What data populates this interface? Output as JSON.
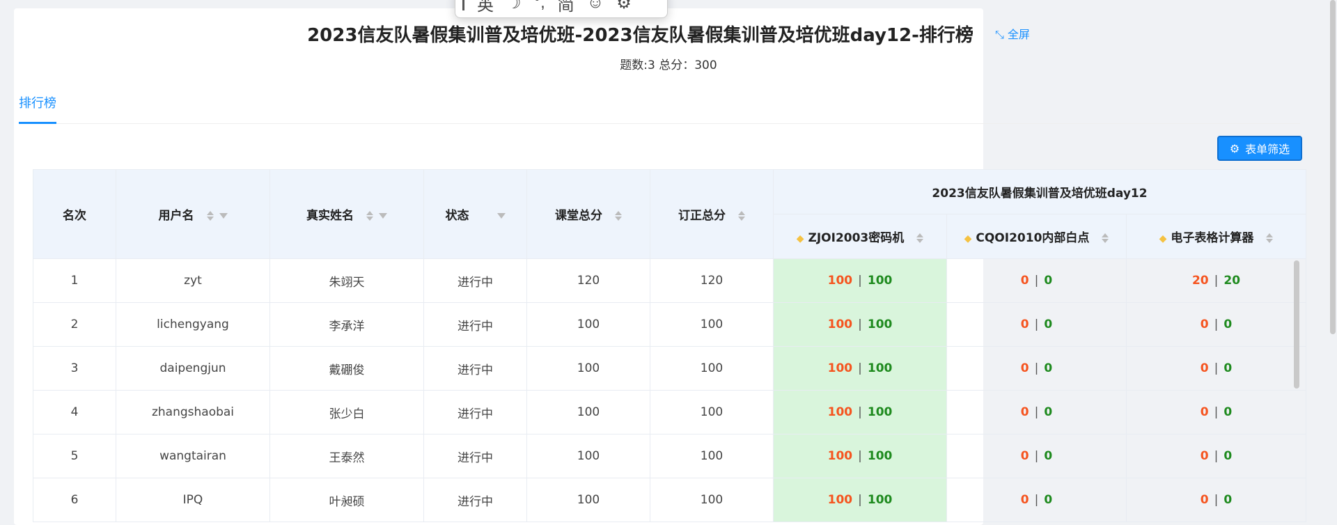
{
  "ime": {
    "lang": "英",
    "moon": "☽",
    "punct": "°,",
    "script": "简",
    "emoji": "☺",
    "settings": "⚙"
  },
  "header": {
    "title": "2023信友队暑假集训普及培优班-2023信友队暑假集训普及培优班day12-排行榜",
    "fullscreen_label": "全屏",
    "subtitle": "题数:3 总分：300"
  },
  "tabs": [
    {
      "label": "排行榜",
      "active": true
    }
  ],
  "filter_button": {
    "label": "表单筛选",
    "icon": "gear-icon"
  },
  "table": {
    "group_header": "2023信友队暑假集训普及培优班day12",
    "columns": [
      "名次",
      "用户名",
      "真实姓名",
      "状态",
      "课堂总分",
      "订正总分"
    ],
    "problems": [
      "ZJOI2003密码机",
      "CQOI2010内部白点",
      "电子表格计算器"
    ],
    "rows": [
      {
        "rank": "1",
        "user": "zyt",
        "name": "朱翊天",
        "status": "进行中",
        "class": "120",
        "fix": "120",
        "p": [
          [
            "100",
            "100"
          ],
          [
            "0",
            "0"
          ],
          [
            "20",
            "20"
          ]
        ]
      },
      {
        "rank": "2",
        "user": "lichengyang",
        "name": "李承洋",
        "status": "进行中",
        "class": "100",
        "fix": "100",
        "p": [
          [
            "100",
            "100"
          ],
          [
            "0",
            "0"
          ],
          [
            "0",
            "0"
          ]
        ]
      },
      {
        "rank": "3",
        "user": "daipengjun",
        "name": "戴硼俊",
        "status": "进行中",
        "class": "100",
        "fix": "100",
        "p": [
          [
            "100",
            "100"
          ],
          [
            "0",
            "0"
          ],
          [
            "0",
            "0"
          ]
        ]
      },
      {
        "rank": "4",
        "user": "zhangshaobai",
        "name": "张少白",
        "status": "进行中",
        "class": "100",
        "fix": "100",
        "p": [
          [
            "100",
            "100"
          ],
          [
            "0",
            "0"
          ],
          [
            "0",
            "0"
          ]
        ]
      },
      {
        "rank": "5",
        "user": "wangtairan",
        "name": "王泰然",
        "status": "进行中",
        "class": "100",
        "fix": "100",
        "p": [
          [
            "100",
            "100"
          ],
          [
            "0",
            "0"
          ],
          [
            "0",
            "0"
          ]
        ]
      },
      {
        "rank": "6",
        "user": "IPQ",
        "name": "叶昶硕",
        "status": "进行中",
        "class": "100",
        "fix": "100",
        "p": [
          [
            "100",
            "100"
          ],
          [
            "0",
            "0"
          ],
          [
            "0",
            "0"
          ]
        ]
      }
    ]
  },
  "colors": {
    "accent": "#1890ff",
    "score_red": "#f5541f",
    "score_green": "#1e8a1e",
    "ac_bg": "#d9f5dc",
    "header_bg": "#eef4fc"
  }
}
